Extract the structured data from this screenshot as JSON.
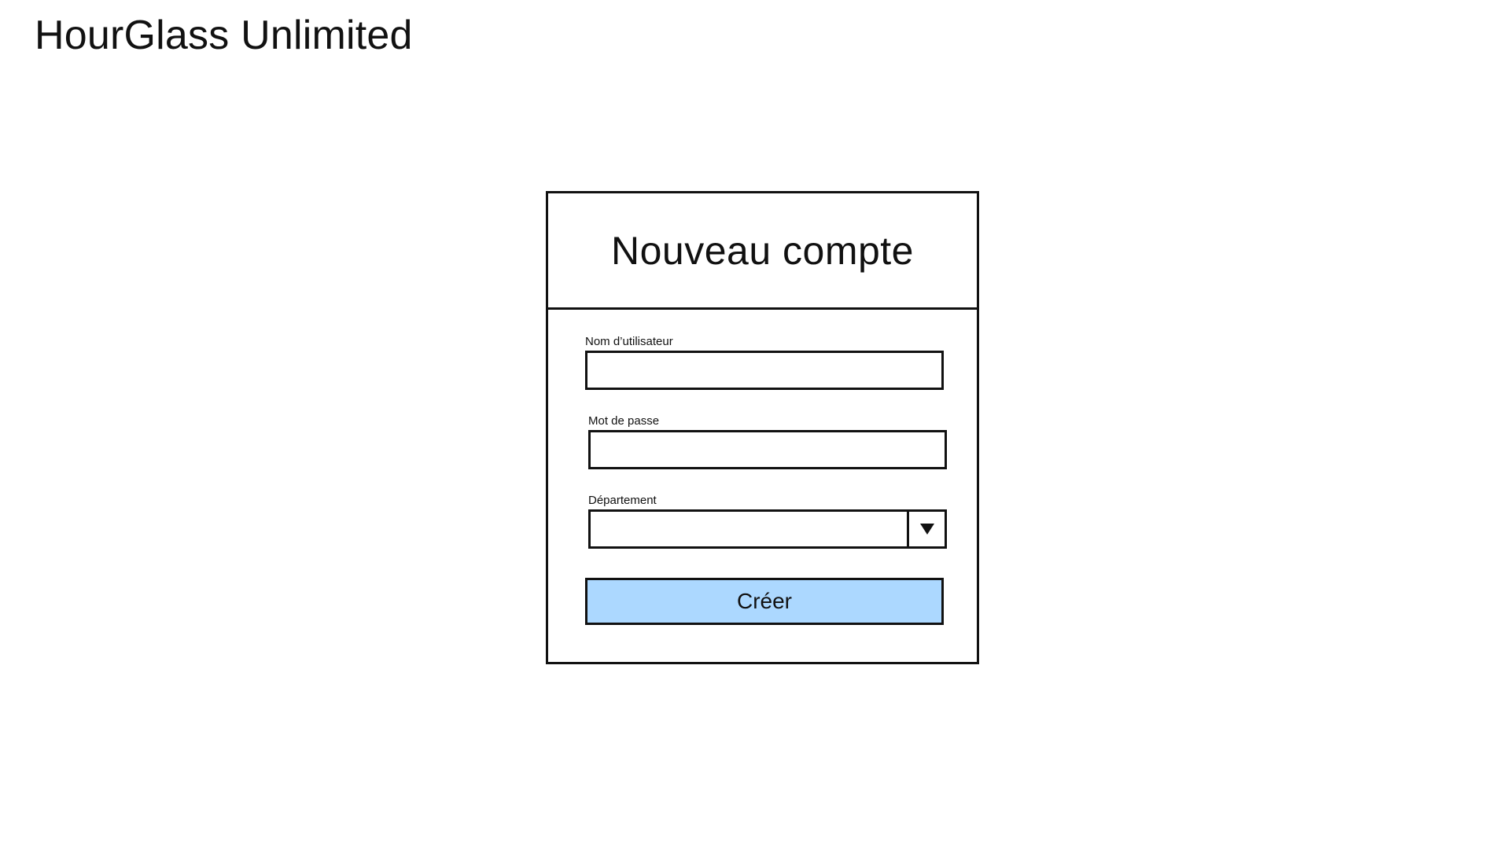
{
  "app": {
    "title": "HourGlass Unlimited"
  },
  "form": {
    "title": "Nouveau compte",
    "fields": [
      {
        "label": "Nom d’utilisateur",
        "value": "",
        "type": "text"
      },
      {
        "label": "Mot de passe",
        "value": "",
        "type": "password"
      },
      {
        "label": "Département",
        "value": "",
        "type": "select"
      }
    ],
    "submit_label": "Créer"
  },
  "icons": {
    "dropdown": "chevron-down-icon"
  },
  "colors": {
    "button_background": "#acd8ff",
    "border": "#111111",
    "background": "#ffffff"
  }
}
